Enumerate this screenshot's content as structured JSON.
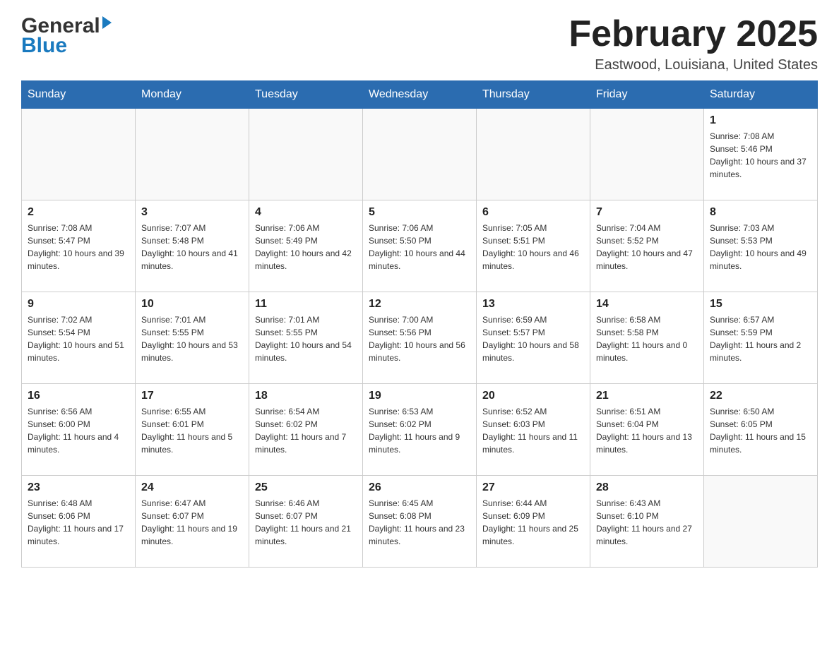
{
  "header": {
    "logo_line1": "General",
    "logo_line2": "Blue",
    "month_title": "February 2025",
    "location": "Eastwood, Louisiana, United States"
  },
  "weekdays": [
    "Sunday",
    "Monday",
    "Tuesday",
    "Wednesday",
    "Thursday",
    "Friday",
    "Saturday"
  ],
  "weeks": [
    [
      {
        "day": "",
        "sunrise": "",
        "sunset": "",
        "daylight": ""
      },
      {
        "day": "",
        "sunrise": "",
        "sunset": "",
        "daylight": ""
      },
      {
        "day": "",
        "sunrise": "",
        "sunset": "",
        "daylight": ""
      },
      {
        "day": "",
        "sunrise": "",
        "sunset": "",
        "daylight": ""
      },
      {
        "day": "",
        "sunrise": "",
        "sunset": "",
        "daylight": ""
      },
      {
        "day": "",
        "sunrise": "",
        "sunset": "",
        "daylight": ""
      },
      {
        "day": "1",
        "sunrise": "Sunrise: 7:08 AM",
        "sunset": "Sunset: 5:46 PM",
        "daylight": "Daylight: 10 hours and 37 minutes."
      }
    ],
    [
      {
        "day": "2",
        "sunrise": "Sunrise: 7:08 AM",
        "sunset": "Sunset: 5:47 PM",
        "daylight": "Daylight: 10 hours and 39 minutes."
      },
      {
        "day": "3",
        "sunrise": "Sunrise: 7:07 AM",
        "sunset": "Sunset: 5:48 PM",
        "daylight": "Daylight: 10 hours and 41 minutes."
      },
      {
        "day": "4",
        "sunrise": "Sunrise: 7:06 AM",
        "sunset": "Sunset: 5:49 PM",
        "daylight": "Daylight: 10 hours and 42 minutes."
      },
      {
        "day": "5",
        "sunrise": "Sunrise: 7:06 AM",
        "sunset": "Sunset: 5:50 PM",
        "daylight": "Daylight: 10 hours and 44 minutes."
      },
      {
        "day": "6",
        "sunrise": "Sunrise: 7:05 AM",
        "sunset": "Sunset: 5:51 PM",
        "daylight": "Daylight: 10 hours and 46 minutes."
      },
      {
        "day": "7",
        "sunrise": "Sunrise: 7:04 AM",
        "sunset": "Sunset: 5:52 PM",
        "daylight": "Daylight: 10 hours and 47 minutes."
      },
      {
        "day": "8",
        "sunrise": "Sunrise: 7:03 AM",
        "sunset": "Sunset: 5:53 PM",
        "daylight": "Daylight: 10 hours and 49 minutes."
      }
    ],
    [
      {
        "day": "9",
        "sunrise": "Sunrise: 7:02 AM",
        "sunset": "Sunset: 5:54 PM",
        "daylight": "Daylight: 10 hours and 51 minutes."
      },
      {
        "day": "10",
        "sunrise": "Sunrise: 7:01 AM",
        "sunset": "Sunset: 5:55 PM",
        "daylight": "Daylight: 10 hours and 53 minutes."
      },
      {
        "day": "11",
        "sunrise": "Sunrise: 7:01 AM",
        "sunset": "Sunset: 5:55 PM",
        "daylight": "Daylight: 10 hours and 54 minutes."
      },
      {
        "day": "12",
        "sunrise": "Sunrise: 7:00 AM",
        "sunset": "Sunset: 5:56 PM",
        "daylight": "Daylight: 10 hours and 56 minutes."
      },
      {
        "day": "13",
        "sunrise": "Sunrise: 6:59 AM",
        "sunset": "Sunset: 5:57 PM",
        "daylight": "Daylight: 10 hours and 58 minutes."
      },
      {
        "day": "14",
        "sunrise": "Sunrise: 6:58 AM",
        "sunset": "Sunset: 5:58 PM",
        "daylight": "Daylight: 11 hours and 0 minutes."
      },
      {
        "day": "15",
        "sunrise": "Sunrise: 6:57 AM",
        "sunset": "Sunset: 5:59 PM",
        "daylight": "Daylight: 11 hours and 2 minutes."
      }
    ],
    [
      {
        "day": "16",
        "sunrise": "Sunrise: 6:56 AM",
        "sunset": "Sunset: 6:00 PM",
        "daylight": "Daylight: 11 hours and 4 minutes."
      },
      {
        "day": "17",
        "sunrise": "Sunrise: 6:55 AM",
        "sunset": "Sunset: 6:01 PM",
        "daylight": "Daylight: 11 hours and 5 minutes."
      },
      {
        "day": "18",
        "sunrise": "Sunrise: 6:54 AM",
        "sunset": "Sunset: 6:02 PM",
        "daylight": "Daylight: 11 hours and 7 minutes."
      },
      {
        "day": "19",
        "sunrise": "Sunrise: 6:53 AM",
        "sunset": "Sunset: 6:02 PM",
        "daylight": "Daylight: 11 hours and 9 minutes."
      },
      {
        "day": "20",
        "sunrise": "Sunrise: 6:52 AM",
        "sunset": "Sunset: 6:03 PM",
        "daylight": "Daylight: 11 hours and 11 minutes."
      },
      {
        "day": "21",
        "sunrise": "Sunrise: 6:51 AM",
        "sunset": "Sunset: 6:04 PM",
        "daylight": "Daylight: 11 hours and 13 minutes."
      },
      {
        "day": "22",
        "sunrise": "Sunrise: 6:50 AM",
        "sunset": "Sunset: 6:05 PM",
        "daylight": "Daylight: 11 hours and 15 minutes."
      }
    ],
    [
      {
        "day": "23",
        "sunrise": "Sunrise: 6:48 AM",
        "sunset": "Sunset: 6:06 PM",
        "daylight": "Daylight: 11 hours and 17 minutes."
      },
      {
        "day": "24",
        "sunrise": "Sunrise: 6:47 AM",
        "sunset": "Sunset: 6:07 PM",
        "daylight": "Daylight: 11 hours and 19 minutes."
      },
      {
        "day": "25",
        "sunrise": "Sunrise: 6:46 AM",
        "sunset": "Sunset: 6:07 PM",
        "daylight": "Daylight: 11 hours and 21 minutes."
      },
      {
        "day": "26",
        "sunrise": "Sunrise: 6:45 AM",
        "sunset": "Sunset: 6:08 PM",
        "daylight": "Daylight: 11 hours and 23 minutes."
      },
      {
        "day": "27",
        "sunrise": "Sunrise: 6:44 AM",
        "sunset": "Sunset: 6:09 PM",
        "daylight": "Daylight: 11 hours and 25 minutes."
      },
      {
        "day": "28",
        "sunrise": "Sunrise: 6:43 AM",
        "sunset": "Sunset: 6:10 PM",
        "daylight": "Daylight: 11 hours and 27 minutes."
      },
      {
        "day": "",
        "sunrise": "",
        "sunset": "",
        "daylight": ""
      }
    ]
  ]
}
